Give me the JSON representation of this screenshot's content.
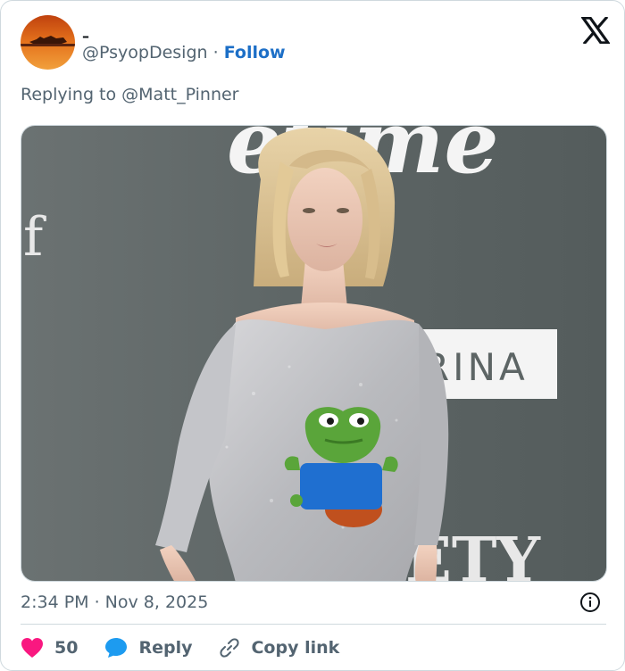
{
  "author": {
    "display_name": "–",
    "handle": "@PsyopDesign",
    "separator": " · ",
    "follow_label": "Follow"
  },
  "reply": {
    "prefix": "Replying to ",
    "mention": "@Matt_Pinner"
  },
  "media": {
    "icons": [
      "blonde-woman-photo",
      "frog-meme-sticker"
    ],
    "backdrop_text": [
      "etime",
      "RINA",
      "ETY"
    ]
  },
  "meta": {
    "timestamp": "2:34 PM · Nov 8, 2025"
  },
  "actions": {
    "like_count": "50",
    "reply_label": "Reply",
    "copy_label": "Copy link"
  },
  "colors": {
    "accent": "#1d6fc7",
    "like": "#f91880",
    "reply_icon": "#1d9bf0",
    "muted": "#536471",
    "border": "#cfd9de"
  }
}
